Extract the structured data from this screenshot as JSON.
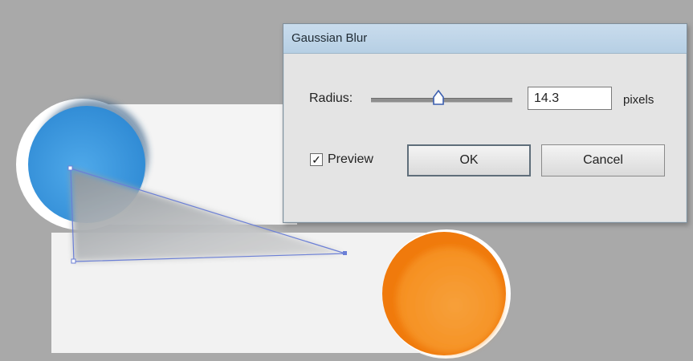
{
  "dialog": {
    "title": "Gaussian Blur",
    "radius_label": "Radius:",
    "radius_value": "14.3",
    "radius_slider_fraction": 0.48,
    "units_label": "pixels",
    "preview_label": "Preview",
    "preview_checked": true,
    "ok_label": "OK",
    "cancel_label": "Cancel"
  },
  "colors": {
    "background": "#a9a9a9",
    "blue_circle": "#3a97de",
    "orange_circle": "#f07a0c",
    "selection_path": "#6b7fd6"
  }
}
